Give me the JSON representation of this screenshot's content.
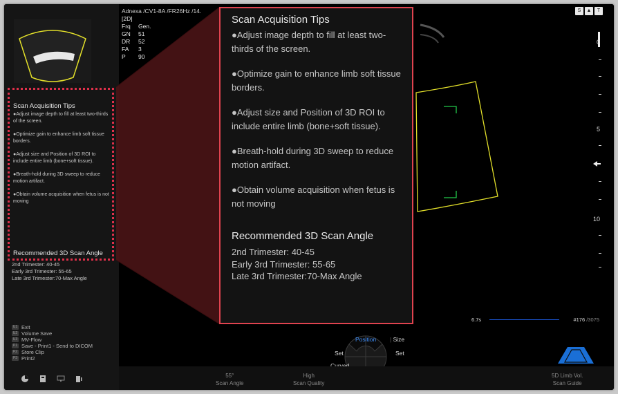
{
  "header": {
    "title": "Adnexa /CV1-8A /FR26Hz /14.",
    "mode": "[2D]",
    "params": [
      {
        "k": "Frq",
        "v": "Gen."
      },
      {
        "k": "GN",
        "v": "51"
      },
      {
        "k": "DR",
        "v": "52"
      },
      {
        "k": "FA",
        "v": "3"
      },
      {
        "k": "P",
        "v": "90"
      }
    ]
  },
  "tips": {
    "heading": "Scan Acquisition Tips",
    "items": [
      "●Adjust image depth to fill at least two-thirds of the screen.",
      "●Optimize gain to enhance limb soft tissue borders.",
      "●Adjust size and Position of 3D ROI to include entire limb (bone+soft tissue).",
      "●Breath-hold during 3D sweep to reduce motion artifact.",
      "●Obtain volume acquisition when fetus is not moving"
    ],
    "angle_heading": "Recommended 3D Scan Angle",
    "angles": [
      "2nd Trimester: 40-45",
      "Early 3rd Trimester: 55-65",
      "Late 3rd Trimester:70-Max Angle"
    ]
  },
  "keys": [
    {
      "tag": "U1",
      "label": "Exit"
    },
    {
      "tag": "U2",
      "label": "Volume Save"
    },
    {
      "tag": "U3",
      "label": "MV-Flow"
    },
    {
      "tag": "P1",
      "label": "Save - Print1 - Send to DICOM"
    },
    {
      "tag": "P2",
      "label": "Store Clip"
    },
    {
      "tag": "P3",
      "label": "Print2"
    }
  ],
  "depth_labels": [
    "0",
    "5",
    "10"
  ],
  "cine": {
    "left": "6.7s",
    "frame": "#176",
    "total": "/3075"
  },
  "wheel": {
    "active": "Position",
    "size": "Size",
    "set_left": "Set",
    "set_right": "Set",
    "curved": "Curved"
  },
  "bottom": {
    "angle_value": "55°",
    "angle_label": "Scan Angle",
    "quality_value": "High",
    "quality_label": "Scan Quality",
    "guide_value": "5D Limb Vol.",
    "guide_label": "Scan Guide"
  },
  "top_icons": [
    "S",
    "▲",
    "T"
  ],
  "colors": {
    "accent_red": "#e0434f",
    "roi_yellow": "#e3e02a",
    "roi_green": "#22c84a",
    "cine_blue": "#1c57d8"
  }
}
